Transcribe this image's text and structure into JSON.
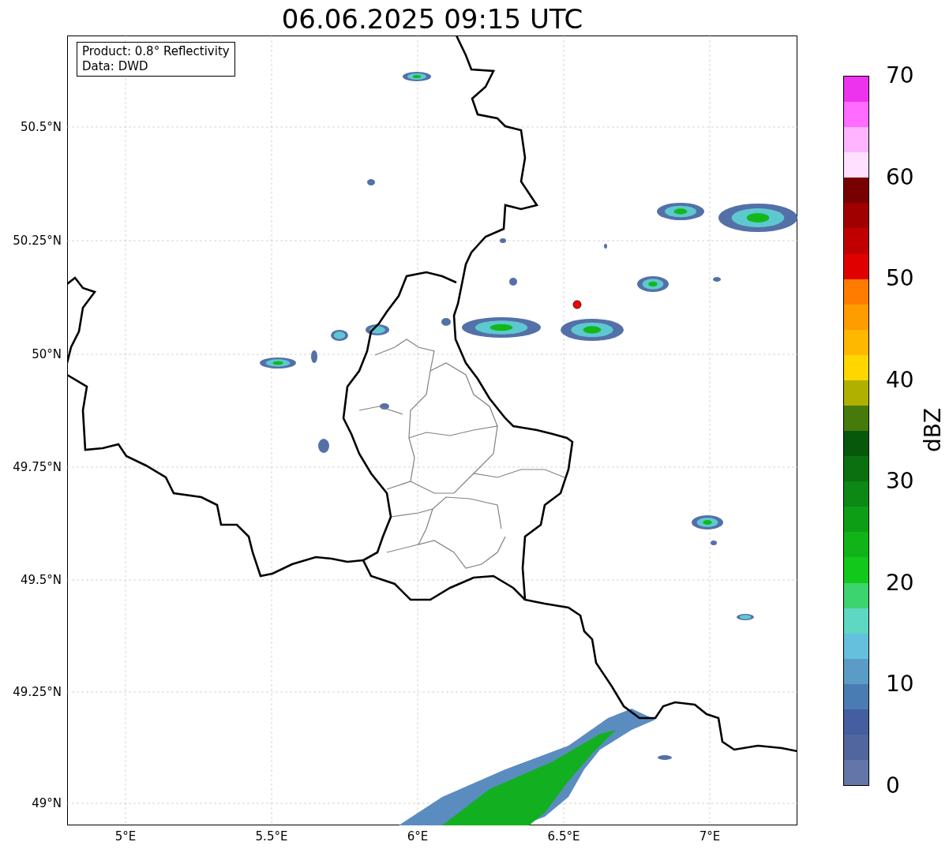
{
  "title": "06.06.2025 09:15 UTC",
  "legend": [
    "Product: 0.8° Reflectivity",
    "Data: DWD"
  ],
  "map": {
    "lat_labels": [
      "50.5°N",
      "50.25°N",
      "50°N",
      "49.75°N",
      "49.5°N",
      "49.25°N",
      "49°N"
    ],
    "lon_labels": [
      "5°E",
      "5.5°E",
      "6°E",
      "6.5°E",
      "7°E"
    ]
  },
  "colorbar": {
    "label": "dBZ",
    "ticks": [
      "70",
      "60",
      "50",
      "40",
      "30",
      "20",
      "10",
      "0"
    ],
    "bins": [
      {
        "color": "#ee33ee"
      },
      {
        "color": "#ff6cff"
      },
      {
        "color": "#ffb4ff"
      },
      {
        "color": "#ffe0ff"
      },
      {
        "color": "#780000"
      },
      {
        "color": "#a00000"
      },
      {
        "color": "#c00000"
      },
      {
        "color": "#e00000"
      },
      {
        "color": "#ff7c00"
      },
      {
        "color": "#ff9c00"
      },
      {
        "color": "#ffb800"
      },
      {
        "color": "#ffd700"
      },
      {
        "color": "#b0b000"
      },
      {
        "color": "#467a0a"
      },
      {
        "color": "#07580a"
      },
      {
        "color": "#0a7010"
      },
      {
        "color": "#0c8814"
      },
      {
        "color": "#0e9e16"
      },
      {
        "color": "#10b418"
      },
      {
        "color": "#12c81a"
      },
      {
        "color": "#3cd46e"
      },
      {
        "color": "#5ed8c2"
      },
      {
        "color": "#64c0dc"
      },
      {
        "color": "#5a9cc6"
      },
      {
        "color": "#4a7cb4"
      },
      {
        "color": "#445ea0"
      },
      {
        "color": "#52669e"
      },
      {
        "color": "#6475a8"
      }
    ]
  }
}
